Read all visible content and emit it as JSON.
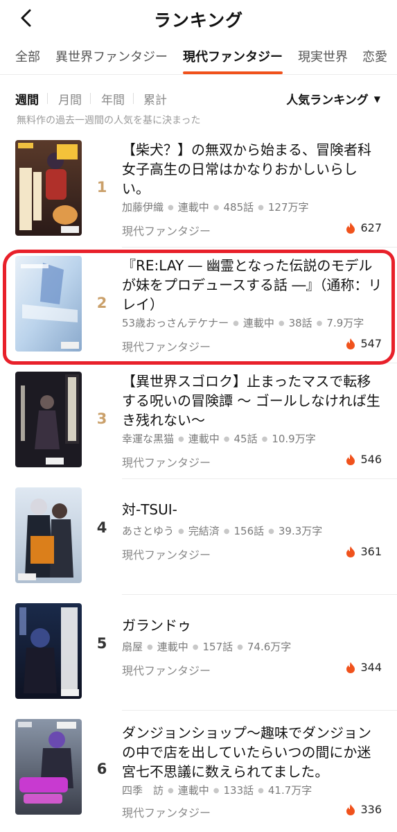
{
  "header": {
    "title": "ランキング"
  },
  "category_tabs": [
    "全部",
    "異世界ファンタジー",
    "現代ファンタジー",
    "現実世界",
    "恋愛"
  ],
  "active_category_index": 2,
  "period_tabs": [
    "週間",
    "月間",
    "年間",
    "累計"
  ],
  "active_period_index": 0,
  "sort": {
    "label": "人気ランキング"
  },
  "note": "無料作の過去一週間の人気を基に決まった",
  "items": [
    {
      "rank": "1",
      "title": "【柴犬？】の無双から始まる、冒険者科女子高生の日常はかなりおかしいらしい。",
      "author": "加藤伊織",
      "status": "連載中",
      "episodes": "485話",
      "chars": "127万字",
      "genre": "現代ファンタジー",
      "heat": "627"
    },
    {
      "rank": "2",
      "title": "『RE:LAY ― 幽霊となった伝説のモデルが妹をプロデュースする話 ―』（通称：リレイ）",
      "author": "53歳おっさんテケナー",
      "status": "連載中",
      "episodes": "38話",
      "chars": "7.9万字",
      "genre": "現代ファンタジー",
      "heat": "547"
    },
    {
      "rank": "3",
      "title": "【異世界スゴロク】止まったマスで転移する呪いの冒険譚 〜 ゴールしなければ生き残れない〜",
      "author": "幸運な黒猫",
      "status": "連載中",
      "episodes": "45話",
      "chars": "10.9万字",
      "genre": "現代ファンタジー",
      "heat": "546"
    },
    {
      "rank": "4",
      "title": "対-TSUI-",
      "author": "あさとゆう",
      "status": "完結済",
      "episodes": "156話",
      "chars": "39.3万字",
      "genre": "現代ファンタジー",
      "heat": "361"
    },
    {
      "rank": "5",
      "title": "ガランドゥ",
      "author": "扇屋",
      "status": "連載中",
      "episodes": "157話",
      "chars": "74.6万字",
      "genre": "現代ファンタジー",
      "heat": "344"
    },
    {
      "rank": "6",
      "title": "ダンジョンショップ〜趣味でダンジョンの中で店を出していたらいつの間にか迷宮七不思議に数えられてました。",
      "author": "四季　訪",
      "status": "連載中",
      "episodes": "133話",
      "chars": "41.7万字",
      "genre": "現代ファンタジー",
      "heat": "336"
    }
  ],
  "colors": {
    "accent": "#f0521c",
    "rank_gold": "#caa06a",
    "annotation": "#e8202a"
  },
  "icons": {
    "back": "chevron-left-icon",
    "heat": "flame-icon",
    "sort": "caret-down-icon"
  }
}
